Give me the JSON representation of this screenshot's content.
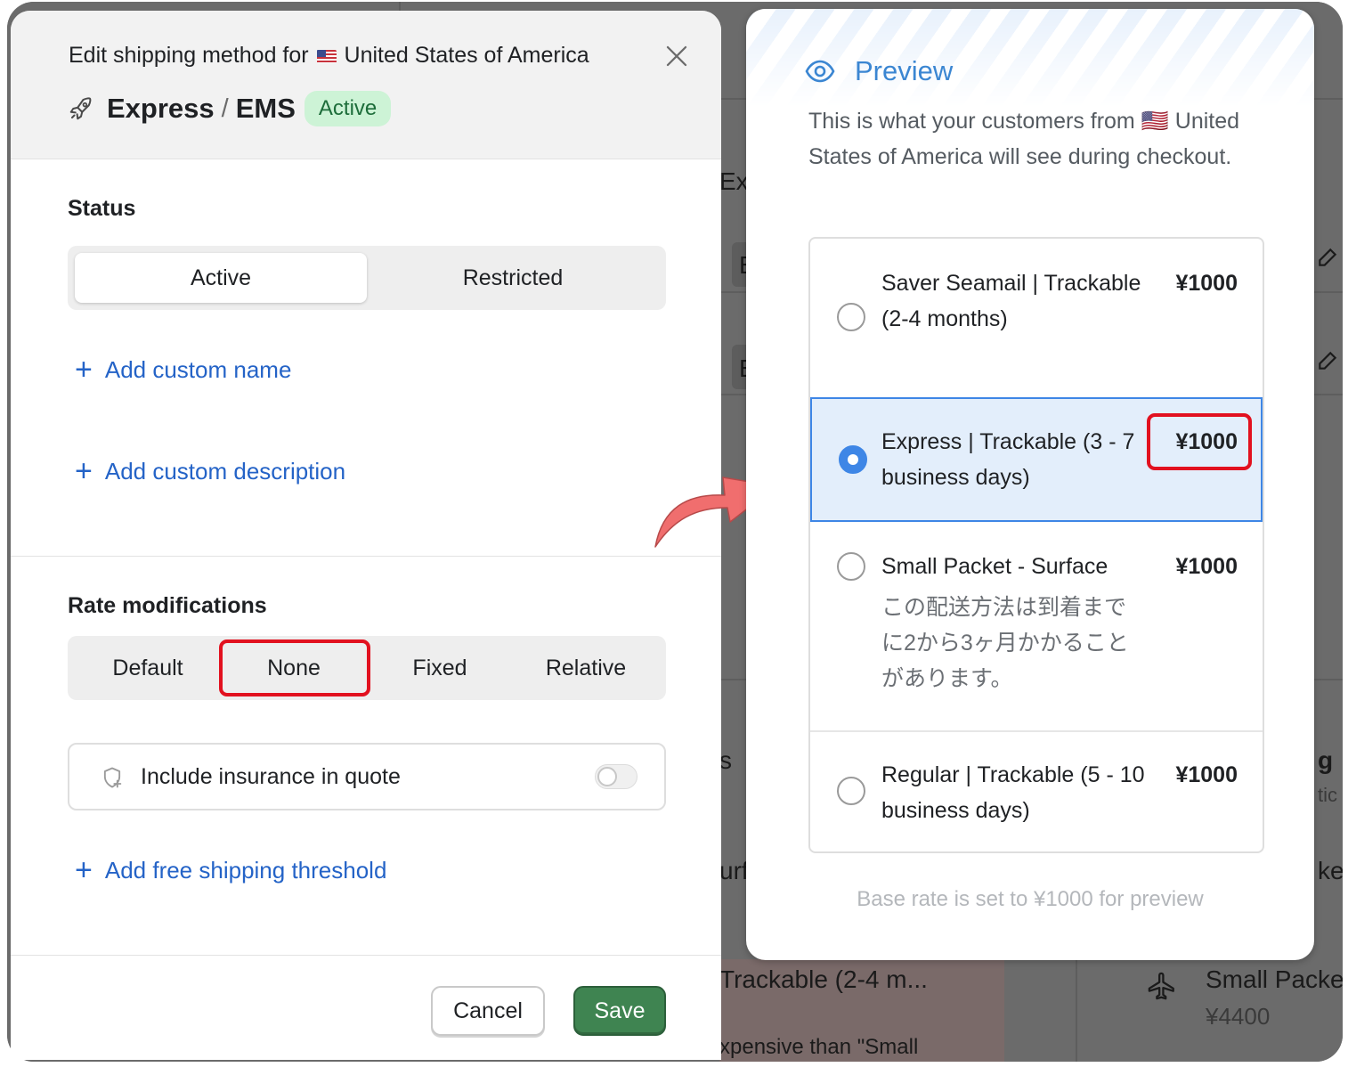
{
  "modal": {
    "title_prefix": "Edit shipping method for",
    "country": "United States of America",
    "method_carrier": "Express",
    "method_separator": "/",
    "method_service": "EMS",
    "status_badge": "Active",
    "status_label": "Status",
    "status_options": [
      "Active",
      "Restricted"
    ],
    "status_selected": "Active",
    "add_custom_name": "Add custom name",
    "add_custom_description": "Add custom description",
    "rate_label": "Rate modifications",
    "rate_options": [
      "Default",
      "None",
      "Fixed",
      "Relative"
    ],
    "rate_selected": "None",
    "insurance_label": "Include insurance in quote",
    "insurance_enabled": false,
    "add_free_shipping": "Add free shipping threshold",
    "cancel_label": "Cancel",
    "save_label": "Save"
  },
  "preview": {
    "title": "Preview",
    "description": "This is what your customers from 🇺🇸 United States of America will see during checkout.",
    "options": [
      {
        "name": "Saver Seamail | Trackable (2-4 months)",
        "price": "¥1000",
        "note": "",
        "selected": false
      },
      {
        "name": "Express | Trackable (3 - 7 business days)",
        "price": "¥1000",
        "note": "",
        "selected": true
      },
      {
        "name": "Small Packet - Surface",
        "price": "¥1000",
        "note": "この配送方法は到着までに2から3ヶ月かかることがあります。",
        "selected": false
      },
      {
        "name": "Regular | Trackable (5 - 10 business days)",
        "price": "¥1000",
        "note": "",
        "selected": false
      }
    ],
    "footer": "Base rate is set to ¥1000 for preview"
  },
  "background": {
    "fragment_exc": "Exc",
    "fragment_e1": "E",
    "fragment_e2": "E",
    "fragment_s": "s",
    "fragment_urf": "urf",
    "fragment_g": "g",
    "fragment_tic": "tic",
    "fragment_ke": "ke",
    "fragment_trackable": "Trackable (2-4 m...",
    "fragment_expensive": "xpensive than \"Small",
    "fragment_small_packet": "Small Packe",
    "fragment_price": "¥4400"
  },
  "colors": {
    "link_blue": "#2463c7",
    "save_green": "#3f8451",
    "highlight_red": "#e2111f",
    "preview_blue": "#3b86d2",
    "arrow_coral": "#f06e6e"
  }
}
